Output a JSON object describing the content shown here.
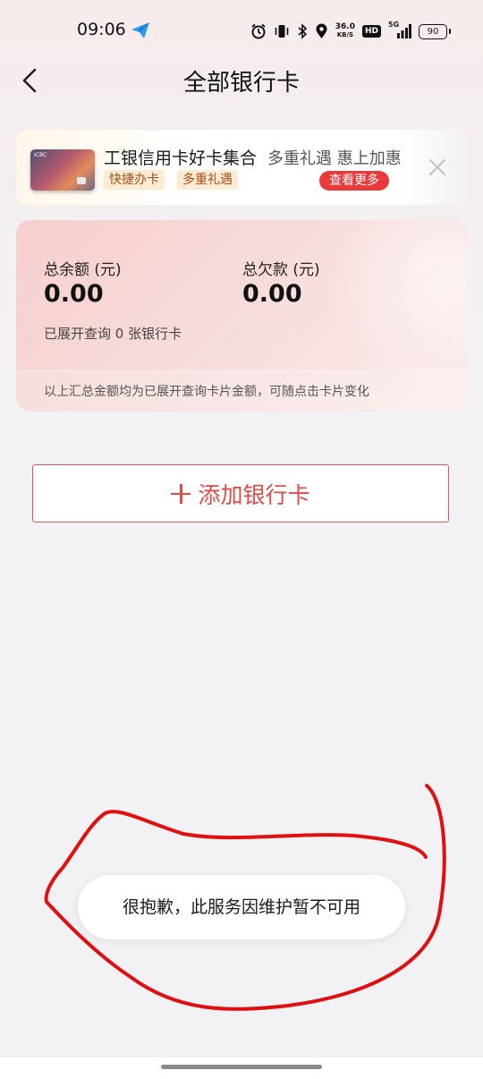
{
  "status_bar": {
    "time": "09:06",
    "net_speed_value": "36.0",
    "net_speed_unit": "KB/S",
    "hd_label": "HD",
    "network_label": "5G",
    "battery_level": "90"
  },
  "nav": {
    "title": "全部银行卡"
  },
  "promo": {
    "card_logo": "ICBC",
    "title": "工银信用卡好卡集合",
    "subtitle": "多重礼遇 惠上加惠",
    "tags": [
      "快捷办卡",
      "多重礼遇"
    ],
    "more_button": "查看更多"
  },
  "summary": {
    "balance_label": "总余额 (元)",
    "balance_value": "0.00",
    "debt_label": "总欠款 (元)",
    "debt_value": "0.00",
    "opened_text": "已展开查询 0 张银行卡",
    "footer_note": "以上汇总金额均为已展开查询卡片金额，可随点击卡片变化"
  },
  "add_card": {
    "label": "添加银行卡"
  },
  "toast": {
    "message": "很抱歉，此服务因维护暂不可用"
  },
  "colors": {
    "accent_red": "#e04a4a",
    "button_red": "#e83a3a",
    "tag_bg": "#fdebd4",
    "tag_text": "#a8501a",
    "annotation_red": "#e01010"
  }
}
